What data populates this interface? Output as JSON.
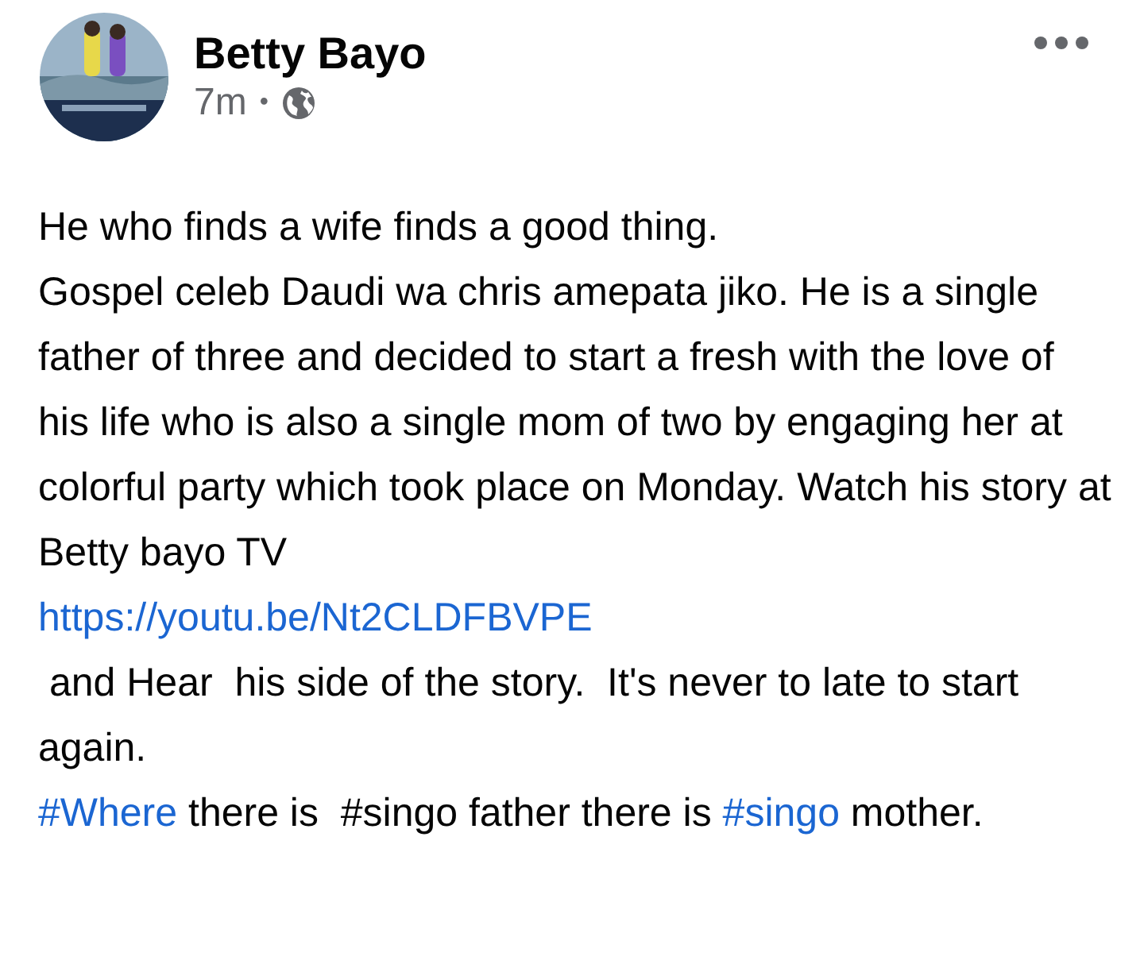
{
  "post": {
    "author": "Betty Bayo",
    "time": "7m",
    "separator": "•",
    "avatar": {
      "kind": "picture"
    },
    "paragraphs": [
      [
        {
          "kind": "text",
          "text": "He who finds a wife finds a good thing."
        }
      ],
      [
        {
          "kind": "text",
          "text": "Gospel celeb Daudi wa chris amepata jiko. He is a single father of three and decided to start a fresh with the love of his life who is also a single mom of two by engaging her at colorful party which took place on Monday. Watch his story at Betty bayo TV"
        }
      ],
      [
        {
          "kind": "link",
          "text": "https://youtu.be/Nt2CLDFBVPE"
        }
      ],
      [
        {
          "kind": "text",
          "text": " and Hear  his side of the story.  It's never to late to start again."
        }
      ],
      [
        {
          "kind": "hashtag",
          "text": "#Where"
        },
        {
          "kind": "text",
          "text": " there is  #singo father there is "
        },
        {
          "kind": "hashtag",
          "text": "#singo"
        },
        {
          "kind": "text",
          "text": " mother."
        }
      ]
    ]
  }
}
